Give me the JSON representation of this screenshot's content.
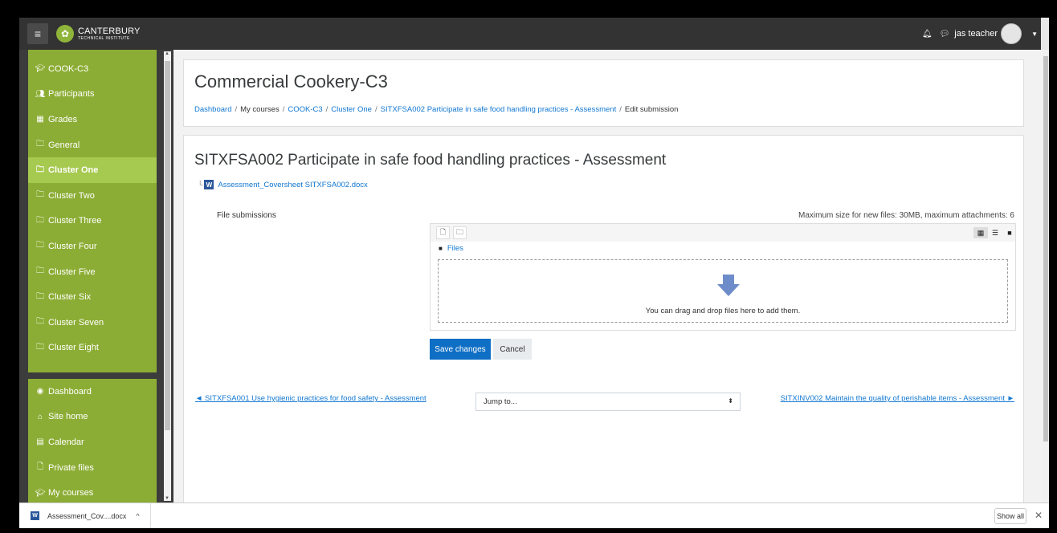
{
  "navbar": {
    "logo_name": "CANTERBURY",
    "logo_sub": "TECHNICAL INSTITUTE",
    "user_name": "jas teacher"
  },
  "sidebar": {
    "course_items": [
      {
        "label": "COOK-C3",
        "icon": "graduation-cap-icon"
      },
      {
        "label": "Participants",
        "icon": "users-icon"
      },
      {
        "label": "Grades",
        "icon": "table-icon"
      },
      {
        "label": "General",
        "icon": "folder-icon"
      },
      {
        "label": "Cluster One",
        "icon": "folder-icon",
        "active": true
      },
      {
        "label": "Cluster Two",
        "icon": "folder-icon"
      },
      {
        "label": "Cluster Three",
        "icon": "folder-icon"
      },
      {
        "label": "Cluster Four",
        "icon": "folder-icon"
      },
      {
        "label": "Cluster Five",
        "icon": "folder-icon"
      },
      {
        "label": "Cluster Six",
        "icon": "folder-icon"
      },
      {
        "label": "Cluster Seven",
        "icon": "folder-icon"
      },
      {
        "label": "Cluster Eight",
        "icon": "folder-icon"
      }
    ],
    "site_items": [
      {
        "label": "Dashboard",
        "icon": "dashboard-icon"
      },
      {
        "label": "Site home",
        "icon": "home-icon"
      },
      {
        "label": "Calendar",
        "icon": "calendar-icon"
      },
      {
        "label": "Private files",
        "icon": "file-icon"
      },
      {
        "label": "My courses",
        "icon": "graduation-cap-icon"
      }
    ]
  },
  "header": {
    "title": "Commercial Cookery-C3",
    "breadcrumb": [
      "Dashboard",
      "My courses",
      "COOK-C3",
      "Cluster One",
      "SITXFSA002 Participate in safe food handling practices - Assessment",
      "Edit submission"
    ]
  },
  "assignment": {
    "title": "SITXFSA002 Participate in safe food handling practices - Assessment",
    "attachment": "Assessment_Coversheet SITXFSA002.docx",
    "file_label": "File submissions",
    "max_size_text": "Maximum size for new files: 30MB, maximum attachments: 6",
    "files_path": "Files",
    "drop_text": "You can drag and drop files here to add them.",
    "save_label": "Save changes",
    "cancel_label": "Cancel"
  },
  "navigation": {
    "prev_label": "◄ SITXFSA001 Use hygienic practices for food safety - Assessment",
    "jump_label": "Jump to...",
    "next_label": "SITXINV002 Maintain the quality of perishable items - Assessment ►"
  },
  "download_bar": {
    "file_name": "Assessment_Cov....docx",
    "show_all_label": "Show all"
  },
  "colors": {
    "sidebar_green": "#8cad35",
    "sidebar_active": "#a6c950",
    "link_blue": "#1177d1",
    "primary_button": "#0f6fc5",
    "navbar": "#333333"
  }
}
